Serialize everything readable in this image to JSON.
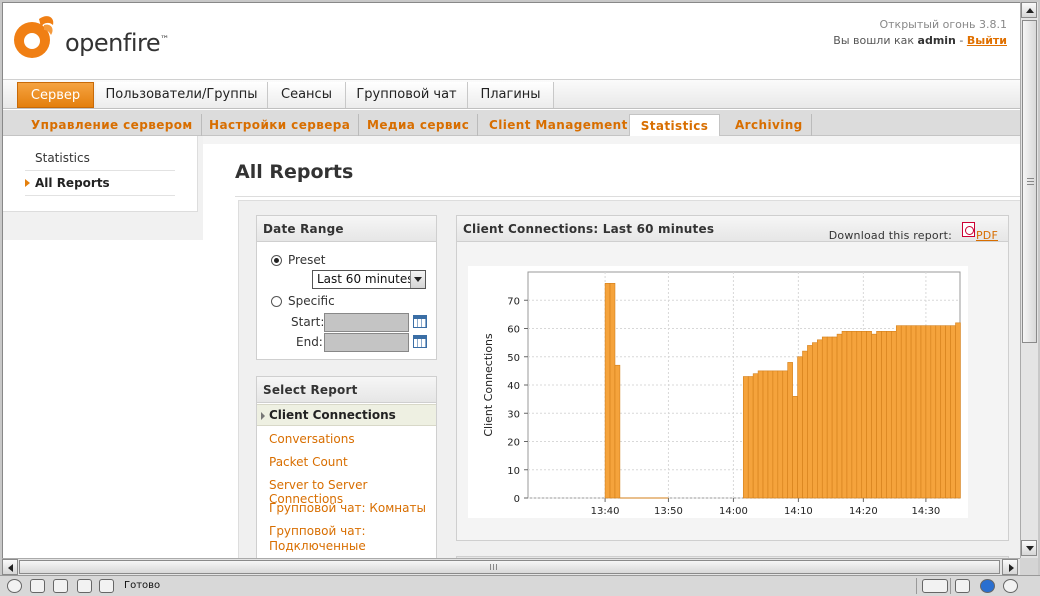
{
  "header": {
    "logo_text": "openfire",
    "logo_tm": "™",
    "version": "Открытый огонь 3.8.1",
    "login_prefix": "Вы вошли как",
    "login_user": "admin",
    "login_sep": "-",
    "logout_label": "Выйти"
  },
  "main_tabs": [
    {
      "label": "Сервер",
      "active": true
    },
    {
      "label": "Пользователи/Группы"
    },
    {
      "label": "Сеансы"
    },
    {
      "label": "Групповой чат"
    },
    {
      "label": "Плагины"
    }
  ],
  "sub_tabs": [
    {
      "label": "Управление сервером"
    },
    {
      "label": "Настройки сервера"
    },
    {
      "label": "Медиа сервис"
    },
    {
      "label": "Client Management"
    },
    {
      "label": "Statistics",
      "active": true
    },
    {
      "label": "Archiving"
    }
  ],
  "sidebar": {
    "items": [
      {
        "label": "Statistics"
      },
      {
        "label": "All Reports",
        "active": true
      }
    ]
  },
  "page_title": "All Reports",
  "date_range": {
    "title": "Date Range",
    "preset_label": "Preset",
    "preset_checked": true,
    "preset_value": "Last 60 minutes",
    "specific_label": "Specific",
    "start_label": "Start:",
    "end_label": "End:",
    "start_value": "",
    "end_value": ""
  },
  "select_report": {
    "title": "Select Report",
    "active": "Client Connections",
    "items": [
      "Conversations",
      "Packet Count",
      "Server to Server Connections",
      "Групповой чат: Комнаты",
      "Групповой чат: Подключенные пользователи"
    ]
  },
  "chart_panel": {
    "title": "Client Connections: Last 60 minutes",
    "download_label": "Download this report:",
    "pdf_label": "PDF"
  },
  "chart_data": {
    "type": "bar",
    "ylabel": "Client Connections",
    "xlabel": "",
    "x_ticks": [
      "13:40",
      "13:50",
      "14:00",
      "14:10",
      "14:20",
      "14:30"
    ],
    "y_ticks": [
      0,
      10,
      20,
      30,
      40,
      50,
      60,
      70
    ],
    "ylim": [
      0,
      80
    ],
    "bar_color": "#f5a33c",
    "grid": true,
    "values": [
      0,
      0,
      0,
      0,
      0,
      0,
      0,
      0,
      0,
      0,
      0,
      0,
      0,
      0,
      0,
      0,
      0,
      0,
      76,
      76,
      47,
      0,
      0,
      0,
      0,
      0,
      0,
      0,
      0,
      0,
      0,
      0,
      0,
      0,
      0,
      0,
      0,
      0,
      0,
      0,
      0,
      0,
      0,
      0,
      0,
      0,
      43,
      43,
      44,
      45,
      45,
      45,
      45,
      45,
      45,
      48,
      36,
      50,
      52,
      54,
      55,
      56,
      57,
      57,
      57,
      58,
      59,
      59,
      59,
      59,
      59,
      59,
      58,
      59,
      59,
      59,
      59,
      61,
      61,
      61,
      61,
      61,
      61,
      61,
      61,
      61,
      61,
      61,
      61,
      62,
      62,
      62,
      62,
      62,
      63
    ]
  },
  "status": {
    "text": "Готово"
  },
  "colors": {
    "accent": "#e47f0d",
    "link": "#d86e00"
  }
}
